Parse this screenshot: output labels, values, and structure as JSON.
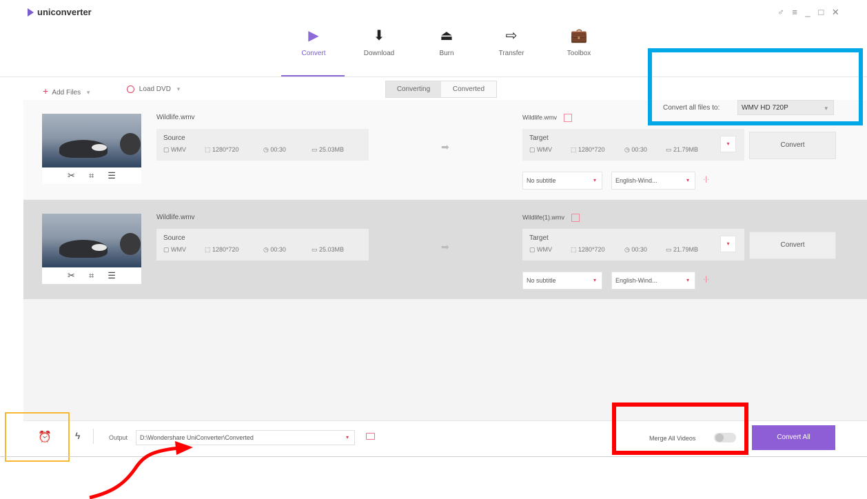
{
  "app": {
    "brand": "uniconverter",
    "window_controls": "♂ ≡ _ □ ✕"
  },
  "nav": [
    {
      "label": "Convert",
      "icon": "▶",
      "icon_name": "convert-play-icon",
      "active": true
    },
    {
      "label": "Download",
      "icon": "⬇",
      "icon_name": "download-icon",
      "active": false
    },
    {
      "label": "Burn",
      "icon": "⏏",
      "icon_name": "burn-disc-icon",
      "active": false
    },
    {
      "label": "Transfer",
      "icon": "⇨",
      "icon_name": "transfer-icon",
      "active": false
    },
    {
      "label": "Toolbox",
      "icon": "💼",
      "icon_name": "toolbox-icon",
      "active": false
    }
  ],
  "toolbar": {
    "add_files": "Add Files",
    "load_dvd": "Load DVD",
    "tabs": [
      "Converting",
      "Converted"
    ],
    "convert_all_to_label": "Convert all files to:",
    "convert_all_to_value": "WMV HD 720P"
  },
  "files": [
    {
      "name": "Wildlife.wmv",
      "source_label": "Source",
      "source": {
        "format": "WMV",
        "resolution": "1280*720",
        "duration": "00:30",
        "size": "25.03MB"
      },
      "target_name": "Wildlife.wmv",
      "target_label": "Target",
      "target": {
        "format": "WMV",
        "resolution": "1280*720",
        "duration": "00:30",
        "size": "21.79MB"
      },
      "convert": "Convert",
      "subtitle": "No subtitle",
      "audio": "English-Wind..."
    },
    {
      "name": "Wildlife.wmv",
      "source_label": "Source",
      "source": {
        "format": "WMV",
        "resolution": "1280*720",
        "duration": "00:30",
        "size": "25.03MB"
      },
      "target_name": "Wildlife(1).wmv",
      "target_label": "Target",
      "target": {
        "format": "WMV",
        "resolution": "1280*720",
        "duration": "00:30",
        "size": "21.79MB"
      },
      "convert": "Convert",
      "subtitle": "No subtitle",
      "audio": "English-Wind..."
    }
  ],
  "bottom": {
    "output_label": "Output",
    "output_path": "D:\\Wondershare UniConverter\\Converted",
    "merge_label": "Merge All Videos",
    "merge_on": false,
    "convert_all": "Convert All"
  },
  "colors": {
    "accent": "#8e5ed6",
    "highlight_blue": "#00a8e8",
    "highlight_red": "#ff0000",
    "highlight_orange": "#f7b733"
  }
}
